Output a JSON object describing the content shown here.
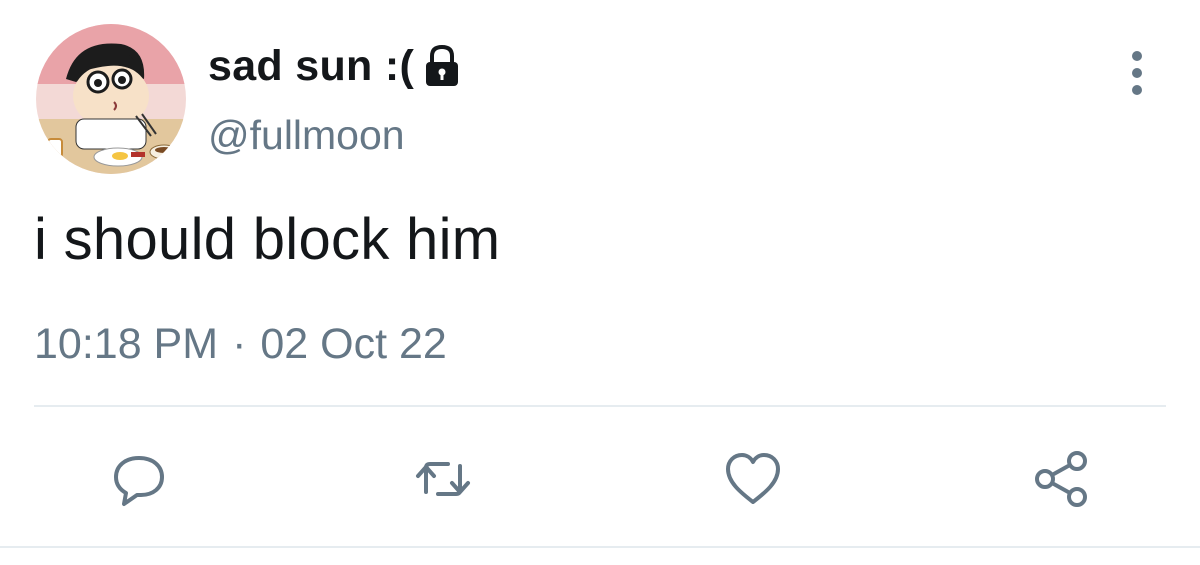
{
  "tweet": {
    "display_name": "sad sun :(",
    "handle": "@fullmoon",
    "text": "i should block him",
    "time": "10:18 PM",
    "separator": "·",
    "date": "02 Oct 22"
  },
  "icons": {
    "avatar": "cartoon-avatar",
    "lock": "lock-icon",
    "more": "more-vertical-icon",
    "reply": "reply-icon",
    "retweet": "retweet-icon",
    "like": "heart-icon",
    "share": "share-icon"
  },
  "colors": {
    "text": "#14171a",
    "secondary": "#657786",
    "divider": "#e6ecf0"
  }
}
